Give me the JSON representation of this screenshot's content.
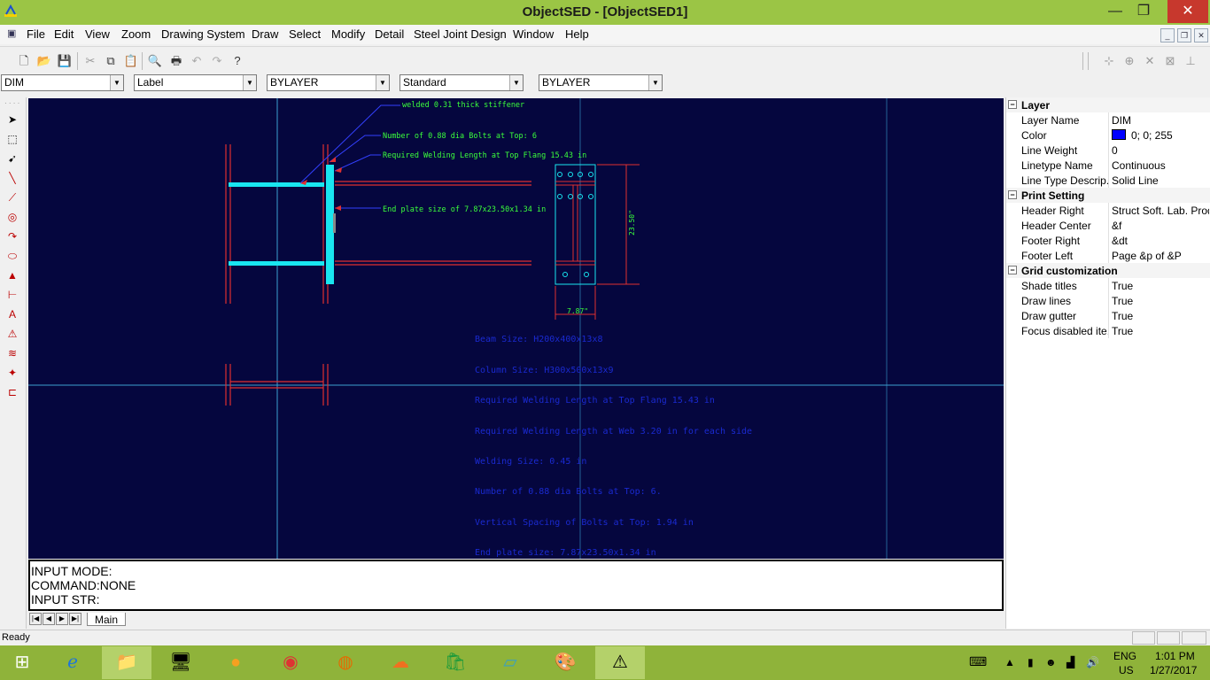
{
  "window": {
    "title": "ObjectSED - [ObjectSED1]",
    "minimize": "—",
    "maximize": "❐",
    "close": "✕"
  },
  "menu": [
    "File",
    "Edit",
    "View",
    "Zoom",
    "Drawing System",
    "Draw",
    "Select",
    "Modify",
    "Detail",
    "Steel Joint Design",
    "Window",
    "Help"
  ],
  "combos": [
    "DIM",
    "Label",
    "BYLAYER",
    "Standard",
    "BYLAYER"
  ],
  "drawing": {
    "callouts": [
      "welded 0.31 thick stiffener",
      "Number of 0.88 dia Bolts at Top: 6",
      "Required Welding Length at Top Flang 15.43 in",
      "End plate size of 7.87x23.50x1.34 in"
    ],
    "dim_height": "23.50\"",
    "dim_width": "7.87\"",
    "notes": [
      "Beam Size: H200x400x13x8",
      "Column Size: H300x500x13x9",
      "Required Welding Length at Top Flang 15.43 in",
      "Required Welding Length at Web 3.20 in for each side",
      "Welding Size: 0.45 in",
      "Number of 0.88 dia Bolts at Top: 6.",
      "Vertical Spacing of Bolts at Top: 1.94 in",
      "End plate size: 7.87x23.50x1.34 in"
    ],
    "colors": {
      "background": "#05063e",
      "steel": "#e03030",
      "plate": "#19e6f0",
      "callout": "#3bff3b",
      "leader": "#3340ff",
      "notes": "#1a2ad0"
    }
  },
  "command": {
    "mode": "INPUT MODE:",
    "command": "COMMAND:NONE",
    "input": "INPUT STR:"
  },
  "sheet_tab": "Main",
  "properties": [
    {
      "category": "Layer",
      "rows": [
        {
          "name": "Layer Name",
          "value": "DIM"
        },
        {
          "name": "Color",
          "value": "0; 0; 255",
          "swatch": "#0000ff"
        },
        {
          "name": "Line Weight",
          "value": "0"
        },
        {
          "name": "Linetype Name",
          "value": "Continuous"
        },
        {
          "name": "Line Type Descrip...",
          "value": "Solid Line"
        }
      ]
    },
    {
      "category": "Print Setting",
      "rows": [
        {
          "name": "Header Right",
          "value": "Struct Soft. Lab. Prod..."
        },
        {
          "name": "Header Center",
          "value": "&f"
        },
        {
          "name": "Footer Right",
          "value": "&dt"
        },
        {
          "name": "Footer Left",
          "value": "Page &p of &P"
        }
      ]
    },
    {
      "category": "Grid customization",
      "rows": [
        {
          "name": "Shade titles",
          "value": "True"
        },
        {
          "name": "Draw lines",
          "value": "True"
        },
        {
          "name": "Draw gutter",
          "value": "True"
        },
        {
          "name": "Focus disabled ite...",
          "value": "True"
        }
      ]
    }
  ],
  "status": "Ready",
  "tray": {
    "lang": "ENG",
    "region": "US",
    "time": "1:01 PM",
    "date": "1/27/2017"
  }
}
